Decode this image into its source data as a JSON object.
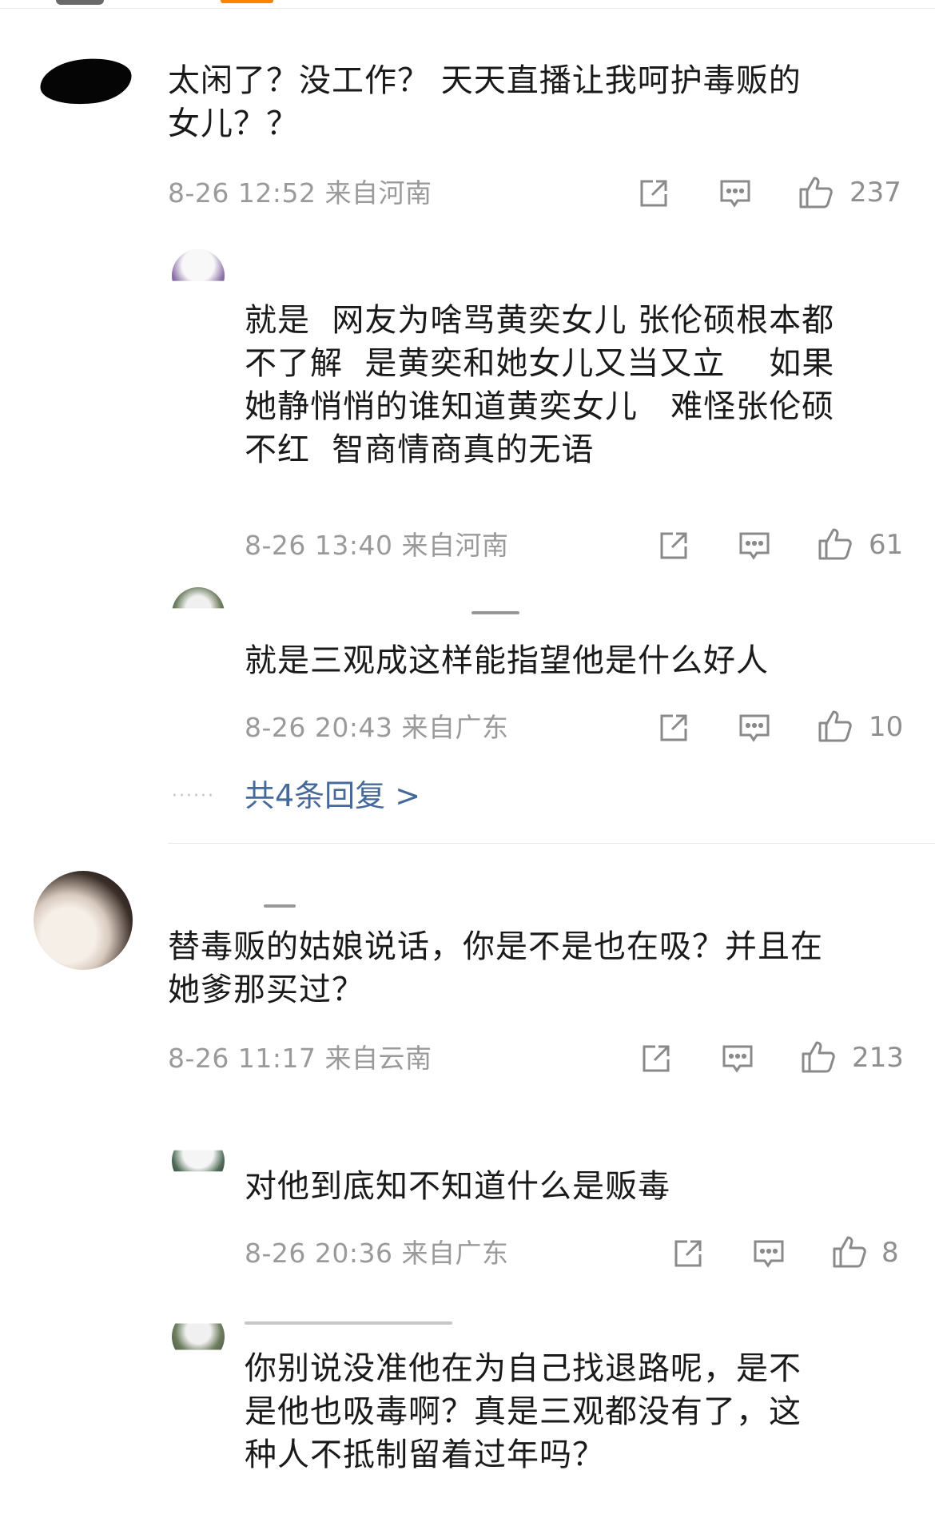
{
  "comments": [
    {
      "text": "太闲了？没工作？ 天天直播让我呵护毒贩的\n女儿？？",
      "meta": "8-26 12:52 来自河南",
      "likes": "237"
    },
    {
      "text": "替毒贩的姑娘说话，你是不是也在吸？并且在\n她爹那买过？",
      "meta": "8-26 11:17 来自云南",
      "likes": "213"
    }
  ],
  "replies": [
    {
      "text": "就是  网友为啥骂黄奕女儿 张伦硕根本都\n不了解  是黄奕和她女儿又当又立    如果\n她静悄悄的谁知道黄奕女儿   难怪张伦硕\n不红  智商情商真的无语",
      "meta": "8-26 13:40 来自河南",
      "likes": "61"
    },
    {
      "text": "就是三观成这样能指望他是什么好人",
      "meta": "8-26 20:43 来自广东",
      "likes": "10"
    },
    {
      "text": "对他到底知不知道什么是贩毒",
      "meta": "8-26 20:36 来自广东",
      "likes": "8"
    },
    {
      "text": "你别说没准他在为自己找退路呢，是不\n是他也吸毒啊？真是三观都没有了，这\n种人不抵制留着过年吗？"
    }
  ],
  "more_replies": "共4条回复 >",
  "colors": {
    "link": "#45699a",
    "meta": "#9a9a9a",
    "icon": "#8a8a8a"
  },
  "icons": [
    "share-icon",
    "comment-icon",
    "like-icon"
  ]
}
